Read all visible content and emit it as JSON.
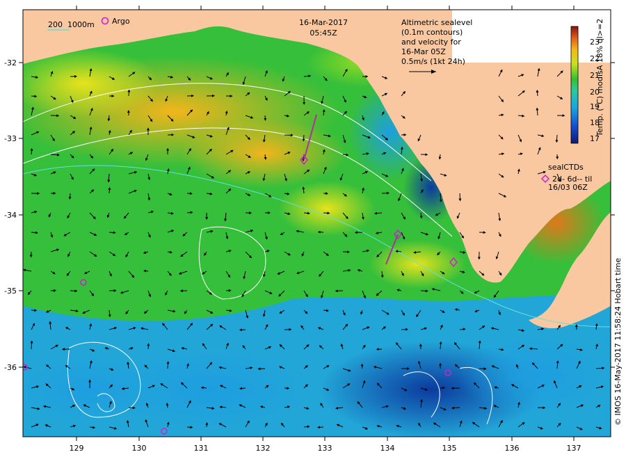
{
  "map": {
    "date_line": "16-Mar-2017",
    "time_line": "05:45Z",
    "depth_legend": {
      "first": "200",
      "second": "1000m"
    },
    "argo_legend": "Argo",
    "altimetry_text": [
      "Altimetric sealevel",
      "(0.1m contours)",
      "and velocity for",
      "16-Mar 05Z",
      "0.5m/s (1kt 24h)"
    ],
    "seal_legend": [
      "sealCTDs",
      "2d- 6d-- til",
      "16/03 06Z"
    ],
    "colorbar": {
      "label": "Temp. (°C) modisA 18% ql>=2",
      "ticks": [
        "17",
        "18",
        "19",
        "20",
        "21",
        "22",
        "23"
      ]
    },
    "longitude_ticks": [
      "129",
      "130",
      "131",
      "132",
      "133",
      "134",
      "135",
      "136",
      "137"
    ],
    "latitude_ticks": [
      "-32",
      "-33",
      "-34",
      "-35",
      "-36"
    ],
    "credit": "© IMOS 16-May-2017 11:58:24 Hobart time",
    "colors": {
      "land": "#f9c8a0",
      "warm": "#f2b81a",
      "mid": "#2fc02f",
      "cool": "#1aa3e0",
      "cold": "#0a2c8c",
      "argo": "#cc22cc",
      "contour": "#ffffff",
      "shelf": "#66e0d8"
    }
  }
}
